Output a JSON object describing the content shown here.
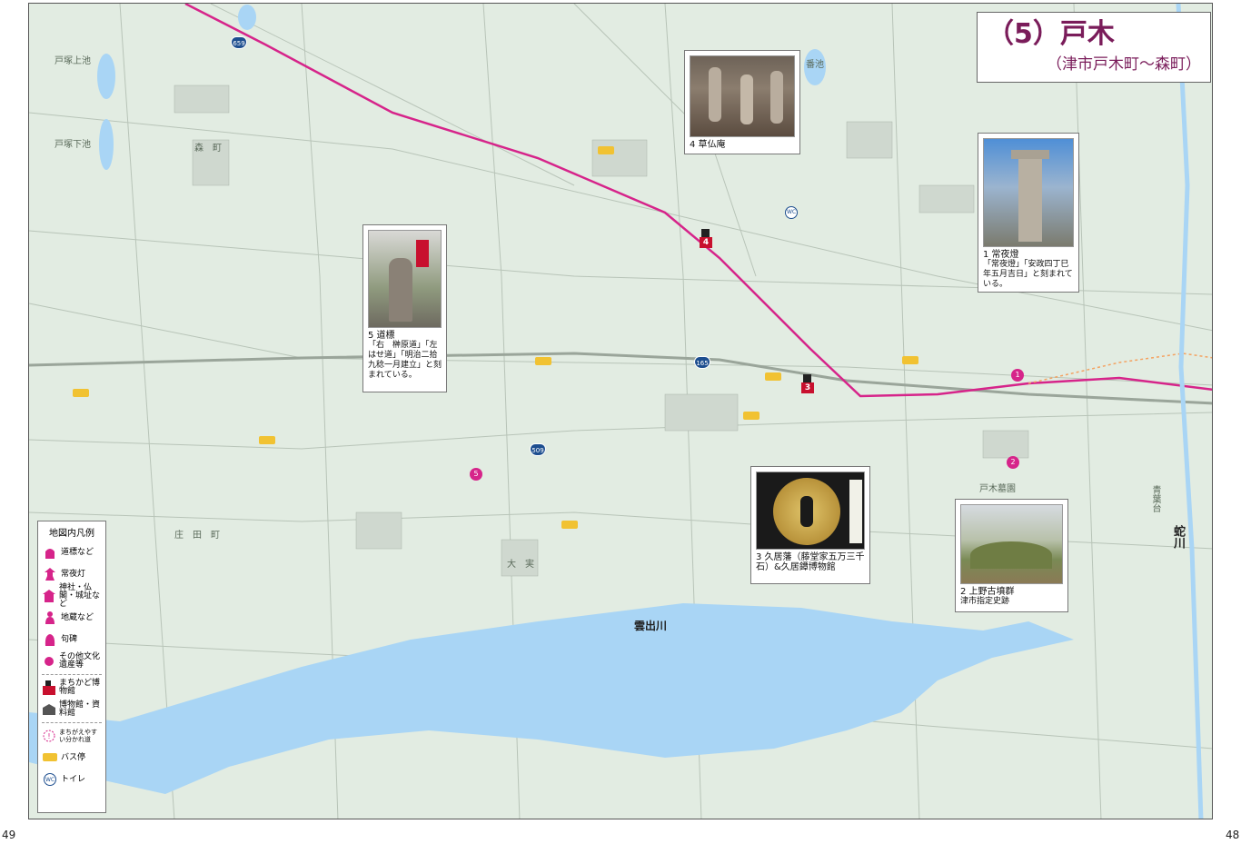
{
  "title": {
    "main": "（5）戸木",
    "sub": "（津市戸木町〜森町）"
  },
  "page_numbers": {
    "left": "49",
    "right": "48"
  },
  "river_labels": {
    "main_river": "雲出川",
    "side_river": "蛇川"
  },
  "route_shields": [
    "659",
    "165",
    "509"
  ],
  "place_labels": [
    "戸塚上池",
    "戸塚下池",
    "森　町",
    "庄　田　町",
    "番池",
    "大　実",
    "戸木墓園",
    "青葉台"
  ],
  "cards": [
    {
      "id": "4",
      "title": "4 草仏庵",
      "text": ""
    },
    {
      "id": "1",
      "title": "1 常夜燈",
      "text": "「常夜燈」「安政四丁巳年五月吉日」と刻まれている。"
    },
    {
      "id": "5",
      "title": "5 道標",
      "text": "「右　榊原道」「左はせ道」「明治二拾九稔一月建立」と刻まれている。"
    },
    {
      "id": "3",
      "title": "3 久居藩（藤堂家五万三千石）&久居鐔博物館",
      "text": ""
    },
    {
      "id": "2",
      "title": "2 上野古墳群",
      "text": "津市指定史跡"
    }
  ],
  "markers": {
    "m1": "1",
    "m2": "2",
    "m3": "3",
    "m4": "4",
    "m5": "5"
  },
  "legend": {
    "title": "地図内凡例",
    "items": [
      {
        "icon": "signpost-icon",
        "label": "道標など"
      },
      {
        "icon": "lantern-icon",
        "label": "常夜灯"
      },
      {
        "icon": "shrine-icon",
        "label": "神社・仏閣・城址など"
      },
      {
        "icon": "jizo-icon",
        "label": "地蔵など"
      },
      {
        "icon": "stone-icon",
        "label": "句碑"
      },
      {
        "icon": "dot-icon",
        "label": "その他文化遺産等"
      },
      {
        "icon": "flag-icon",
        "label": "まちかど博物館"
      },
      {
        "icon": "museum-icon",
        "label": "博物館・資料館"
      },
      {
        "icon": "warning-icon",
        "label": "まちがえやすい分かれ道"
      },
      {
        "icon": "bus-icon",
        "label": "バス停"
      },
      {
        "icon": "toilet-icon",
        "label": "トイレ"
      }
    ]
  },
  "colors": {
    "route": "#d6248a",
    "river": "#a9d5f5",
    "land": "#e2ece2",
    "title": "#7a1c5a"
  },
  "wc_label": "WC"
}
